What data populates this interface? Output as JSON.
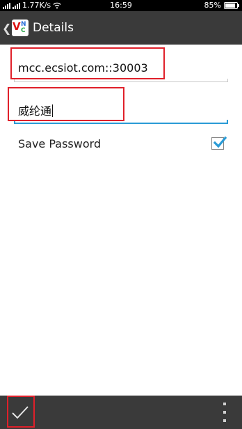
{
  "status_bar": {
    "network_speed": "1.77K/s",
    "time": "16:59",
    "battery": "85%",
    "battery_level": 0.85
  },
  "action_bar": {
    "back_glyph": "❮",
    "app_icon": "vnc-icon",
    "title": "Details"
  },
  "form": {
    "host_value": "mcc.ecsiot.com::30003",
    "nickname_value": "威纶通",
    "save_password_label": "Save Password",
    "save_password_checked": true
  },
  "bottom_bar": {
    "confirm_icon": "checkmark-icon",
    "overflow_icon": "overflow-menu-icon"
  },
  "colors": {
    "action_bar": "#3a3a3a",
    "accent": "#2a9bd6",
    "highlight": "#e0202a"
  }
}
